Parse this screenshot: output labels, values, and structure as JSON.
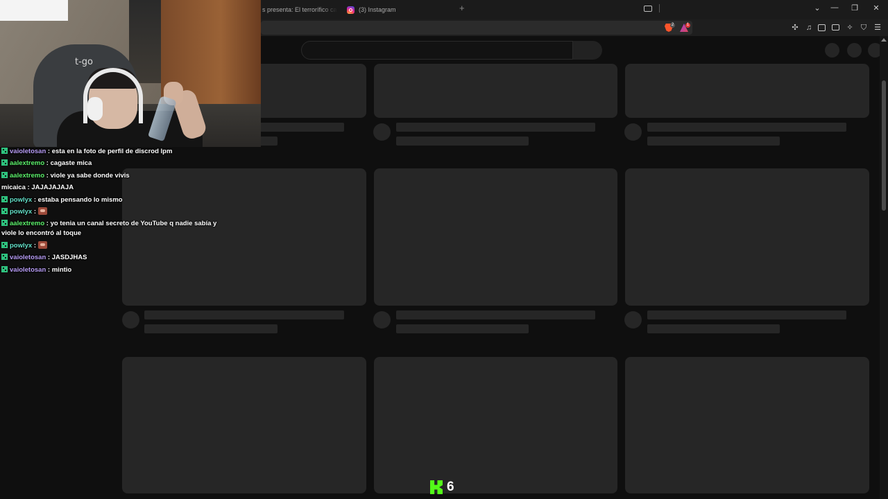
{
  "browser": {
    "tabs": [
      {
        "label": "s presenta: El terrorífico caso d"
      },
      {
        "label": "(3) Instagram"
      }
    ],
    "new_tab_symbol": "+",
    "window_controls": {
      "chevron": "⌄",
      "minimize": "—",
      "restore": "❐",
      "close": "✕"
    },
    "toolbar_icons": [
      "cast-icon",
      "brave-shields-icon",
      "brave-rewards-icon",
      "extensions-icon",
      "music-icon",
      "sidebar-icon",
      "wallet-icon",
      "leo-ai-icon",
      "vpn-icon",
      "menu-icon"
    ],
    "brave_badge": "2",
    "rewards_badge": "1"
  },
  "youtube": {
    "state": "loading-skeleton"
  },
  "chat": {
    "colors": {
      "violet": "#b79cf5",
      "green": "#5cf06b",
      "white": "#ffffff",
      "teal": "#63e0c8"
    },
    "messages": [
      {
        "user": "vaioletosan",
        "separator": " : ",
        "text": "esta en la foto de perfil de discrod lpm",
        "color": "#b79cf5",
        "badge": true
      },
      {
        "user": "aalextremo",
        "separator": " : ",
        "text": "cagaste mica",
        "color": "#5cf06b",
        "badge": true
      },
      {
        "user": "aalextremo",
        "separator": " : ",
        "text": "viole ya sabe donde vivis",
        "color": "#5cf06b",
        "badge": true
      },
      {
        "user": "micaica",
        "separator": " : ",
        "text": "JAJAJAJAJA",
        "color": "#ffffff",
        "badge": false
      },
      {
        "user": "powlyx",
        "separator": " : ",
        "text": "estaba pensando lo mismo",
        "color": "#63e0c8",
        "badge": true
      },
      {
        "user": "powlyx",
        "separator": " : ",
        "text": "",
        "color": "#63e0c8",
        "badge": true,
        "emote": true
      },
      {
        "user": "aalextremo",
        "separator": " : ",
        "text": "yo tenia un canal secreto de YouTube q nadie sabía y viole lo encontró al toque",
        "color": "#5cf06b",
        "badge": true
      },
      {
        "user": "powlyx",
        "separator": " : ",
        "text": "",
        "color": "#63e0c8",
        "badge": true,
        "emote": true
      },
      {
        "user": "vaioletosan",
        "separator": " : ",
        "text": "JASDJHAS",
        "color": "#b79cf5",
        "badge": true
      },
      {
        "user": "vaioletosan",
        "separator": " : ",
        "text": "mintio",
        "color": "#b79cf5",
        "badge": true
      }
    ]
  },
  "webcam": {
    "chair_logo": "t-go"
  },
  "kick": {
    "viewer_count": "6",
    "brand_color": "#53fc18"
  }
}
